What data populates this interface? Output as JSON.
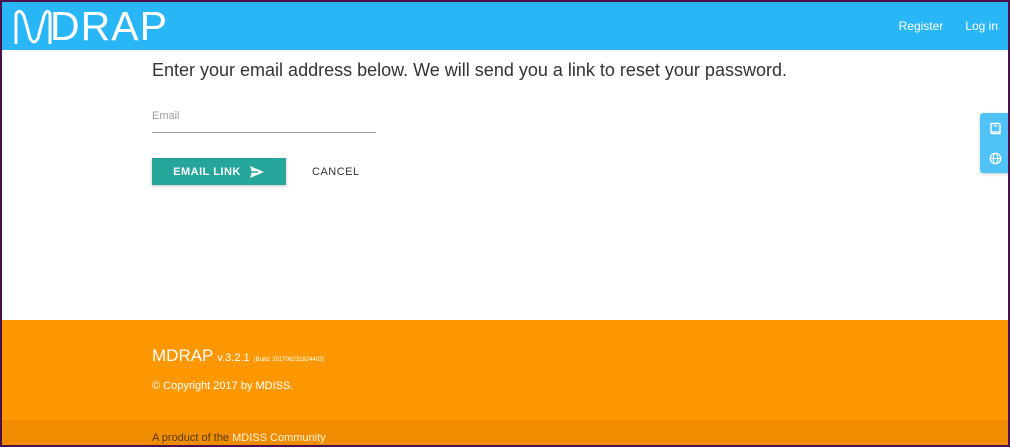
{
  "header": {
    "logo_text": "DRAP",
    "nav": {
      "register": "Register",
      "login": "Log in"
    }
  },
  "main": {
    "instructions": "Enter your email address below. We will send you a link to reset your password.",
    "email_placeholder": "Email",
    "email_value": "",
    "email_link_label": "EMAIL LINK",
    "cancel_label": "CANCEL"
  },
  "side_tools": {
    "icons": [
      "book-icon",
      "globe-icon"
    ]
  },
  "footer": {
    "brand": "MDRAP",
    "version": "v.3.2.1",
    "build": "(Build: 201706231824402)",
    "copyright": "© Copyright 2017 by MDISS.",
    "product_prefix": "A product of the",
    "community_link": "MDISS Community"
  },
  "colors": {
    "topbar": "#29b6f6",
    "primary_button": "#26a69a",
    "footer": "#ff9800",
    "side_tools": "#4fc3f7"
  }
}
